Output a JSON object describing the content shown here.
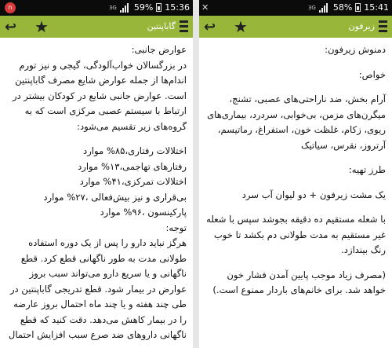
{
  "left_screen": {
    "status": {
      "time": "15:36",
      "battery_percent": "59%",
      "network": "3G"
    },
    "title": "گاباپنتین",
    "content": [
      "عوارض جانبی:",
      "در بزرگسالان خواب‌آلودگی، گیجی و نیز تورم اندام‌ها از جمله عوارض شایع مصرف گاباپنتین است. عوارض جانبی شایع در کودکان بیشتر در ارتباط با سیستم عصبی مرکزی است که به گروه‌های زیر تقسیم می‌شود:",
      "اختلالات رفتاری،۸۵% موارد",
      "رفتارهای تهاجمی،۱۳% موارد",
      "اختلالات تمرکزی،۴۱% موارد",
      "بی‌قراری و نیز بیش‌فعالی ،۲۷% موارد",
      "پارکینسون ،۹۶% موارد",
      "توجه:",
      "هرگز نباید دارو را پس از یک دوره استفاده طولانی مدت به طور ناگهانی قطع کرد. قطع ناگهانی و یا سریع دارو می‌تواند سبب بروز عوارض در بیمار شود. قطع تدریجی گاباپنتین در طی چند هفته و یا چند ماه احتمال بروز عارضه را در بیمار کاهش می‌دهد. دقت کنید که قطع ناگهانی داروهای ضد صرع سبب افزایش احتمال بروز تشنج می شود."
    ]
  },
  "right_screen": {
    "status": {
      "time": "15:41",
      "battery_percent": "58%",
      "network": "3G"
    },
    "title": "زیرفون",
    "content": [
      "دمنوش زیرفون:",
      "خواص:",
      "آرام بخش، ضد ناراحتی‌های عصبی، تشنج، میگرن‌های مزمن، بی‌خوابی، سردرد، بیماری‌های ریوی، زکام، غلظت خون، استفراغ، رماتیسم، آرتروز، نقرس، سیاتیک",
      "طرز تهیه:",
      "یک مشت زیرفون + دو لیوان آب سرد",
      "با شعله مستقیم ده دقیقه بجوشد سپس با شعله غیر مستقیم به مدت طولانی دم بکشد تا خوب رنگ بیندازد.",
      "(مصرف زیاد موجب پایین آمدن فشار خون خواهد شد. برای خانم‌های باردار ممنوع است.)"
    ]
  }
}
